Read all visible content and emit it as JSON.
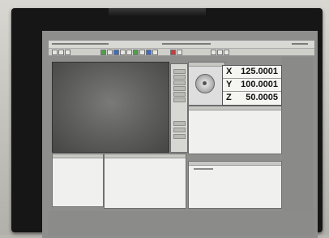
{
  "readout": {
    "x_label": "X",
    "x_value": "125.0001",
    "y_label": "Y",
    "y_value": "100.0001",
    "z_label": "Z",
    "z_value": "50.0005"
  }
}
